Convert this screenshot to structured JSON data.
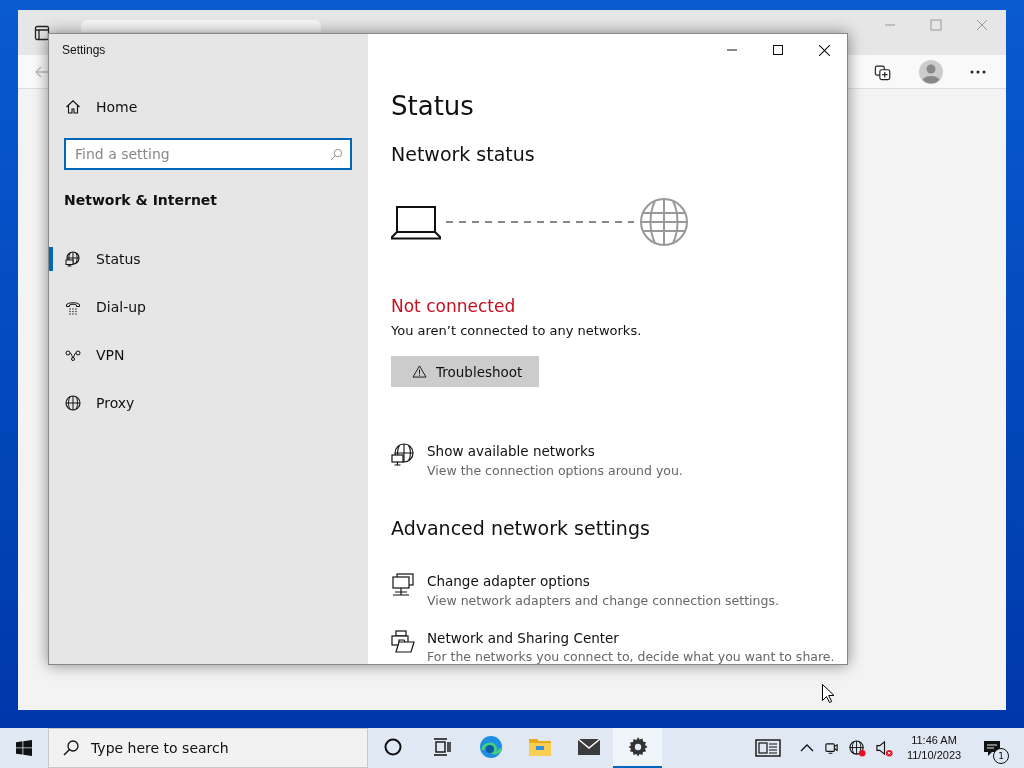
{
  "settings_window": {
    "title": "Settings",
    "home": "Home",
    "search": {
      "placeholder": "Find a setting",
      "focused": true
    },
    "section": "Network & Internet",
    "nav": [
      {
        "kind": "status",
        "label": "Status",
        "selected": true
      },
      {
        "kind": "dialup",
        "label": "Dial-up",
        "selected": false
      },
      {
        "kind": "vpn",
        "label": "VPN",
        "selected": false
      },
      {
        "kind": "proxy",
        "label": "Proxy",
        "selected": false
      }
    ],
    "page_title": "Status",
    "network_status_heading": "Network status",
    "connection": {
      "connected": false,
      "state": "Not connected",
      "message": "You aren’t connected to any networks.",
      "troubleshoot": "Troubleshoot"
    },
    "show_networks": {
      "kind": "networks",
      "title": "Show available networks",
      "subtitle": "View the connection options around you."
    },
    "advanced_heading": "Advanced network settings",
    "advanced_items": [
      {
        "kind": "adapter",
        "title": "Change adapter options",
        "subtitle": "View network adapters and change connection settings."
      },
      {
        "kind": "sharing",
        "title": "Network and Sharing Center",
        "subtitle": "For the networks you connect to, decide what you want to share."
      }
    ]
  },
  "taskbar": {
    "search_placeholder": "Type here to search",
    "apps": [
      {
        "kind": "cortana",
        "selected": false
      },
      {
        "kind": "taskview",
        "selected": false
      },
      {
        "kind": "edge",
        "selected": false
      },
      {
        "kind": "explorer",
        "selected": false
      },
      {
        "kind": "mail",
        "selected": false
      },
      {
        "kind": "settings",
        "selected": true
      }
    ],
    "clock": {
      "time": "11:46 AM",
      "date": "11/10/2023"
    },
    "notification_count": "1"
  }
}
